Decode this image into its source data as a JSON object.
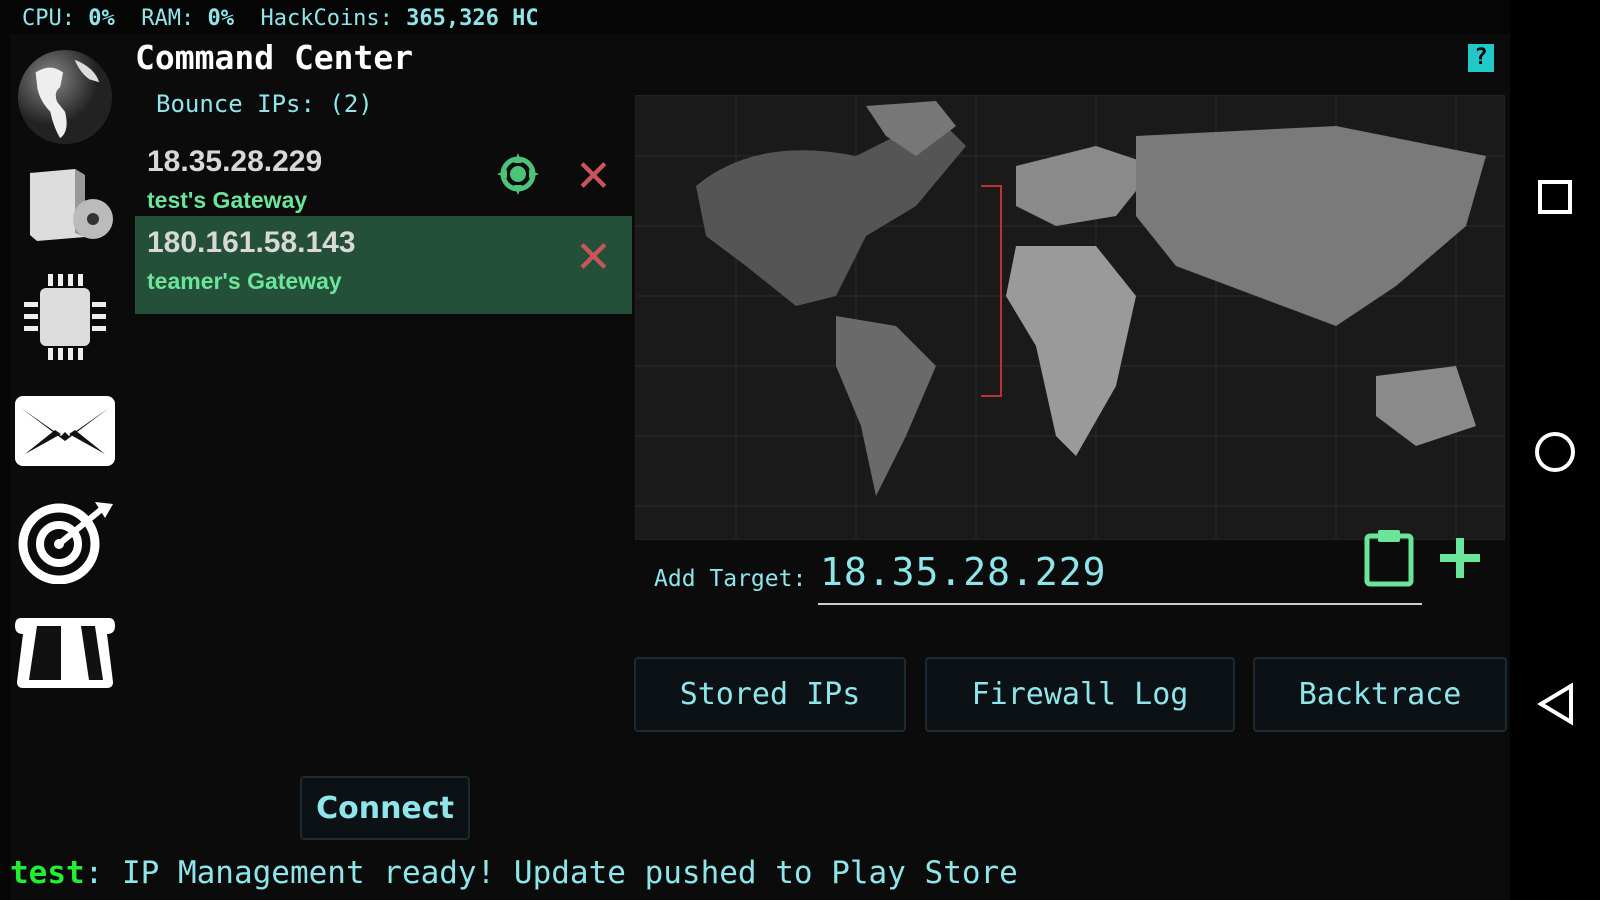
{
  "status_bar": {
    "cpu_label": "CPU:",
    "cpu": "0%",
    "ram_label": "RAM:",
    "ram": "0%",
    "coins_label": "HackCoins:",
    "coins": "365,326 HC"
  },
  "sidebar": {
    "items": [
      {
        "icon": "globe-icon"
      },
      {
        "icon": "software-box-icon"
      },
      {
        "icon": "cpu-chip-icon"
      },
      {
        "icon": "mail-icon"
      },
      {
        "icon": "target-icon"
      },
      {
        "icon": "store-icon"
      }
    ]
  },
  "panel": {
    "title": "Command Center",
    "bounce_label": "Bounce IPs: (2)",
    "bounce_ips": [
      {
        "ip": "18.35.28.229",
        "name": "test's Gateway",
        "selected": false
      },
      {
        "ip": "180.161.58.143",
        "name": "teamer's Gateway",
        "selected": true
      }
    ],
    "help": "?"
  },
  "add_target": {
    "label": "Add Target:",
    "value": "18.35.28.229"
  },
  "buttons": {
    "stored": "Stored IPs",
    "firewall": "Firewall Log",
    "backtrace": "Backtrace",
    "connect": "Connect"
  },
  "message": {
    "user": "test",
    "sep": ":",
    "text": " IP Management ready! Update pushed to Play Store"
  },
  "colors": {
    "accent": "#8ee6ea",
    "green": "#6be59a",
    "selected_row": "#24503a",
    "delete": "#c8555a"
  }
}
